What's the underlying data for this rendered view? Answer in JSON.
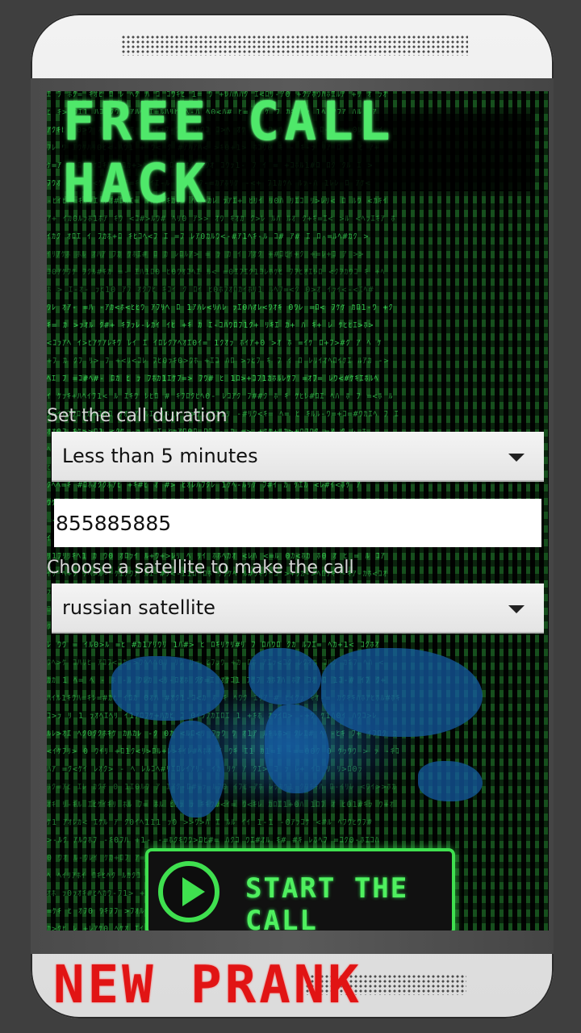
{
  "app": {
    "title": "FREE CALL HACK",
    "promo": "NEW PRANK"
  },
  "form": {
    "duration_label": "Set the call duration",
    "duration_value": "Less than 5 minutes",
    "phone_number": "855885885",
    "satellite_label": "Choose a satellite to make the call",
    "satellite_value": "russian satellite"
  },
  "actions": {
    "start_label": "START THE CALL",
    "start_icon": "play-icon"
  },
  "colors": {
    "matrix_green": "#3be45a",
    "button_green": "#3fe04f",
    "promo_red": "#e11414"
  }
}
